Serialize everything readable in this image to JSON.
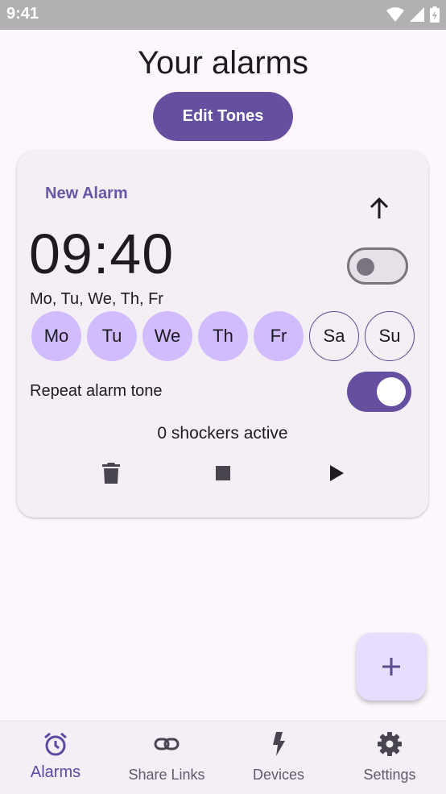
{
  "status_bar": {
    "time": "9:41"
  },
  "header": {
    "title": "Your alarms",
    "edit_tones_label": "Edit Tones"
  },
  "alarm": {
    "name": "New Alarm",
    "time": "09:40",
    "days_summary": "Mo, Tu, We, Th, Fr",
    "days": [
      {
        "label": "Mo",
        "selected": true
      },
      {
        "label": "Tu",
        "selected": true
      },
      {
        "label": "We",
        "selected": true
      },
      {
        "label": "Th",
        "selected": true
      },
      {
        "label": "Fr",
        "selected": true
      },
      {
        "label": "Sa",
        "selected": false
      },
      {
        "label": "Su",
        "selected": false
      }
    ],
    "enabled": false,
    "repeat_label": "Repeat alarm tone",
    "repeat_enabled": true,
    "shockers_text": "0 shockers active",
    "actions": [
      "delete-icon",
      "stop-icon",
      "play-icon"
    ]
  },
  "fab": {
    "icon": "add-icon"
  },
  "nav": {
    "items": [
      {
        "label": "Alarms",
        "icon": "alarm-clock-icon",
        "active": true
      },
      {
        "label": "Share Links",
        "icon": "link-icon",
        "active": false
      },
      {
        "label": "Devices",
        "icon": "bolt-icon",
        "active": false
      },
      {
        "label": "Settings",
        "icon": "gear-icon",
        "active": false
      }
    ]
  },
  "colors": {
    "primary": "#65509f",
    "day_selected": "#d0bcff",
    "background": "#fdf7fd",
    "card": "#f4eff4"
  }
}
